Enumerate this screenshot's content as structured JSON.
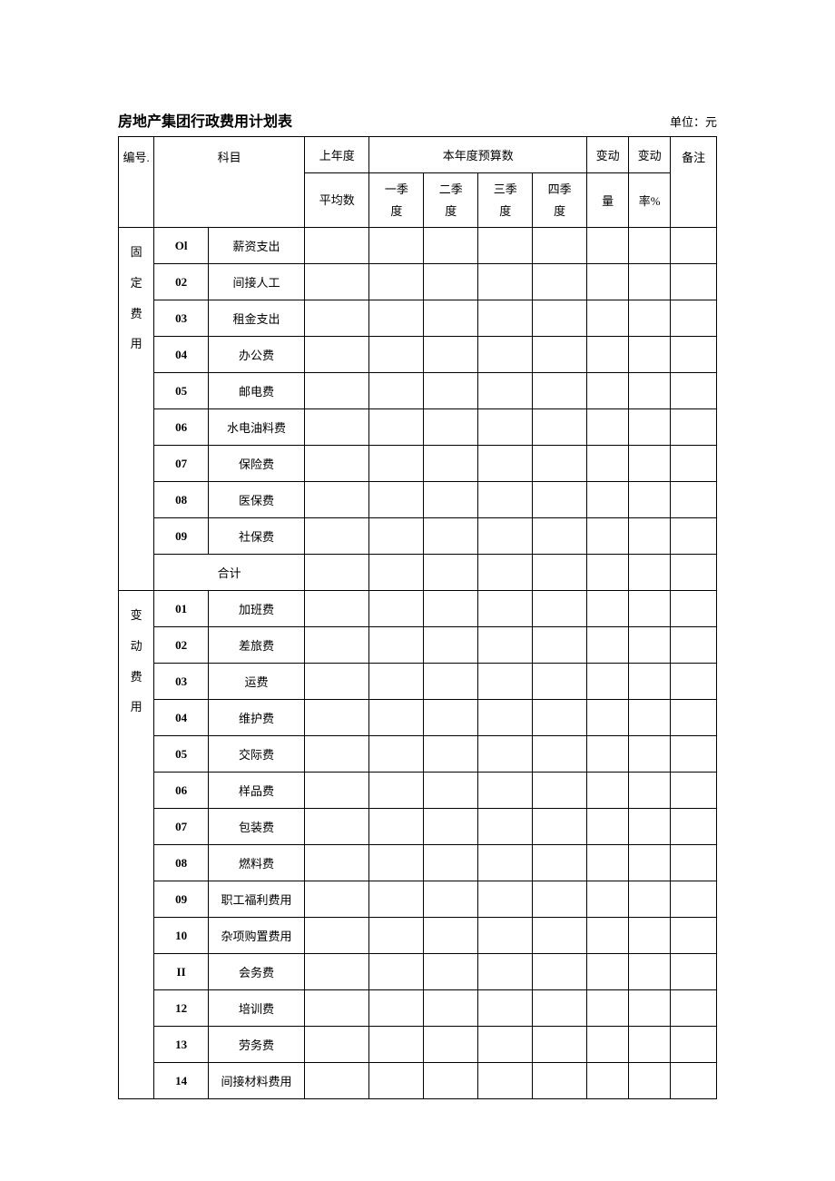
{
  "title": "房地产集团行政费用计划表",
  "unit_label": "单位：元",
  "headers": {
    "serial": "编号.",
    "subject": "科目",
    "prev_year": "上年度",
    "prev_year_sub": "平均数",
    "budget": "本年度预算数",
    "q1": "一季度",
    "q2": "二季度",
    "q3": "三季度",
    "q4": "四季度",
    "change_amt": "变动量",
    "change_rate": "变动率%",
    "remark": "备注"
  },
  "sections": [
    {
      "category": "固定费用",
      "rows": [
        {
          "num": "Ol",
          "item": "薪资支出"
        },
        {
          "num": "02",
          "item": "间接人工"
        },
        {
          "num": "03",
          "item": "租金支出"
        },
        {
          "num": "04",
          "item": "办公费"
        },
        {
          "num": "05",
          "item": "邮电费"
        },
        {
          "num": "06",
          "item": "水电油料费"
        },
        {
          "num": "07",
          "item": "保险费"
        },
        {
          "num": "08",
          "item": "医保费"
        },
        {
          "num": "09",
          "item": "社保费"
        }
      ],
      "subtotal": "合计"
    },
    {
      "category": "变动费用",
      "rows": [
        {
          "num": "01",
          "item": "加班费"
        },
        {
          "num": "02",
          "item": "差旅费"
        },
        {
          "num": "03",
          "item": "运费"
        },
        {
          "num": "04",
          "item": "维护费"
        },
        {
          "num": "05",
          "item": "交际费"
        },
        {
          "num": "06",
          "item": "样品费"
        },
        {
          "num": "07",
          "item": "包装费"
        },
        {
          "num": "08",
          "item": "燃料费"
        },
        {
          "num": "09",
          "item": "职工福利费用"
        },
        {
          "num": "10",
          "item": "杂项购置费用"
        },
        {
          "num": "II",
          "item": "会务费"
        },
        {
          "num": "12",
          "item": "培训费"
        },
        {
          "num": "13",
          "item": "劳务费"
        },
        {
          "num": "14",
          "item": "间接材料费用"
        }
      ]
    }
  ]
}
